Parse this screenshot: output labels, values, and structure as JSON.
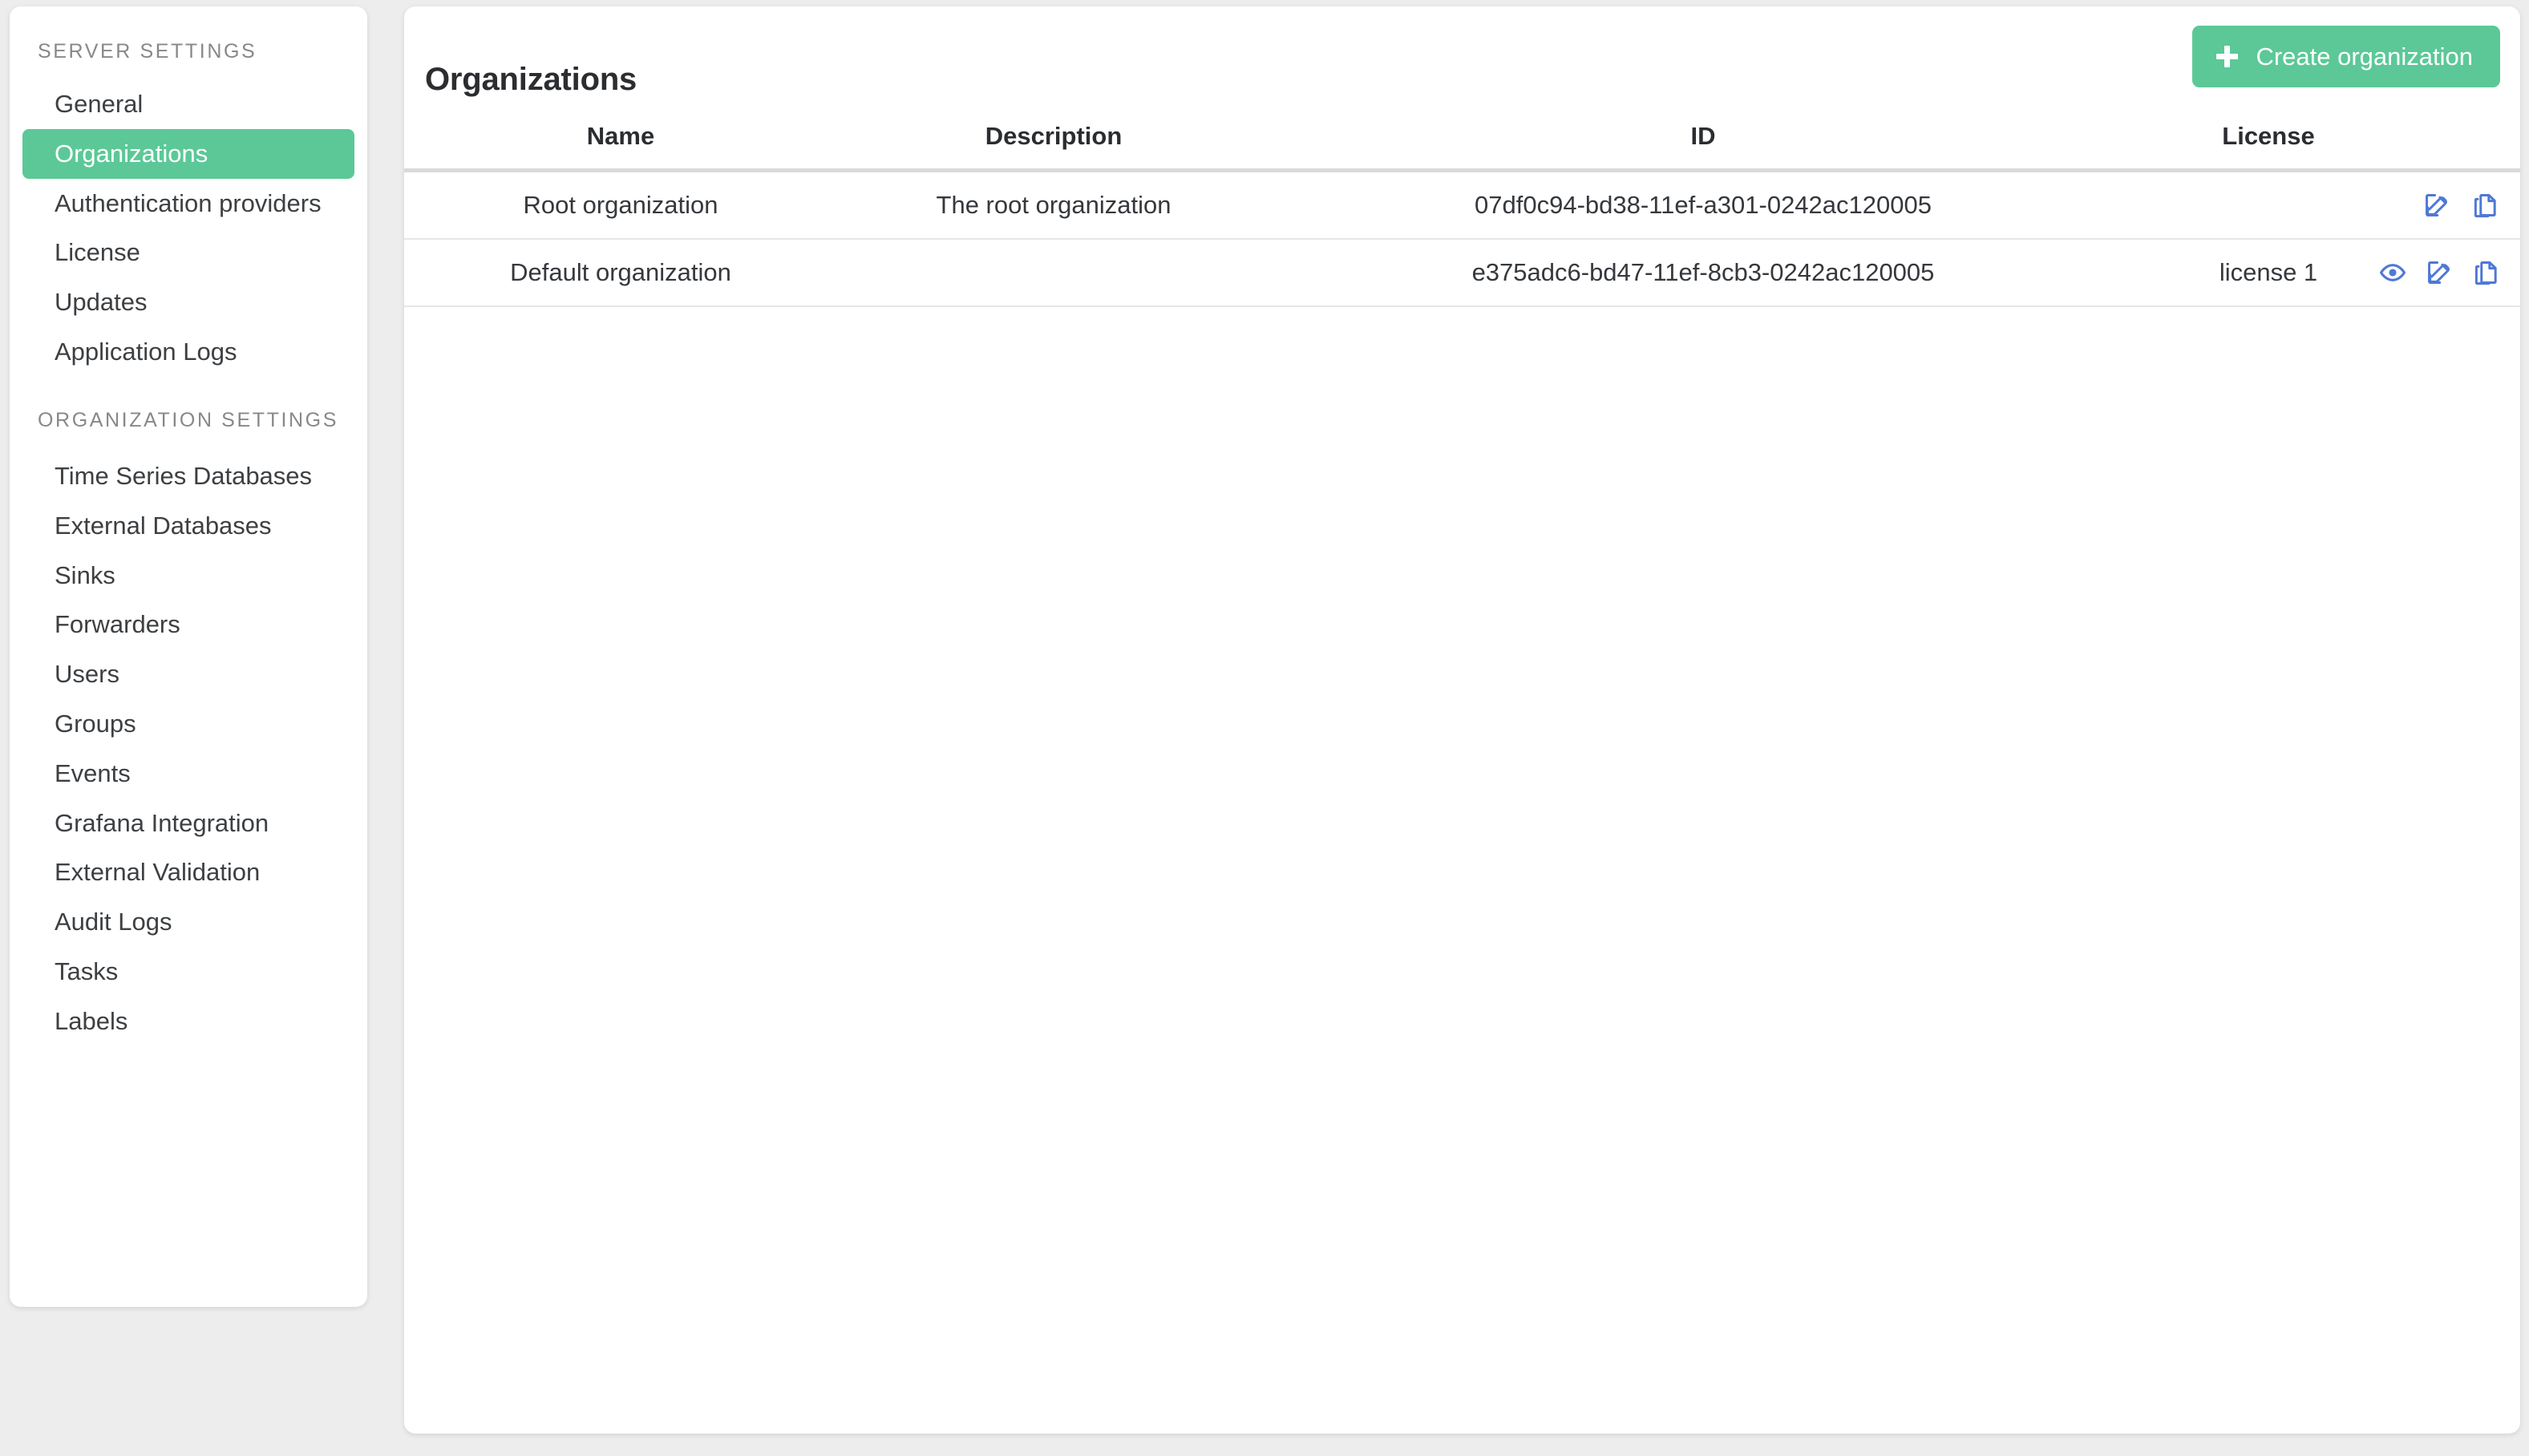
{
  "sidebar": {
    "sections": [
      {
        "title": "SERVER SETTINGS",
        "items": [
          {
            "label": "General",
            "active": false
          },
          {
            "label": "Organizations",
            "active": true
          },
          {
            "label": "Authentication providers",
            "active": false
          },
          {
            "label": "License",
            "active": false
          },
          {
            "label": "Updates",
            "active": false
          },
          {
            "label": "Application Logs",
            "active": false
          }
        ]
      },
      {
        "title": "ORGANIZATION SETTINGS",
        "items": [
          {
            "label": "Time Series Databases",
            "active": false
          },
          {
            "label": "External Databases",
            "active": false
          },
          {
            "label": "Sinks",
            "active": false
          },
          {
            "label": "Forwarders",
            "active": false
          },
          {
            "label": "Users",
            "active": false
          },
          {
            "label": "Groups",
            "active": false
          },
          {
            "label": "Events",
            "active": false
          },
          {
            "label": "Grafana Integration",
            "active": false
          },
          {
            "label": "External Validation",
            "active": false
          },
          {
            "label": "Audit Logs",
            "active": false
          },
          {
            "label": "Tasks",
            "active": false
          },
          {
            "label": "Labels",
            "active": false
          }
        ]
      }
    ]
  },
  "header": {
    "title": "Organizations",
    "create_button_label": "Create organization",
    "create_button_icon": "plus-icon",
    "accent_color": "#5cc897"
  },
  "table": {
    "columns": [
      "Name",
      "Description",
      "ID",
      "License"
    ],
    "rows": [
      {
        "name": "Root organization",
        "description": "The root organization",
        "id": "07df0c94-bd38-11ef-a301-0242ac120005",
        "license": "",
        "actions": [
          "edit-icon",
          "copy-icon"
        ]
      },
      {
        "name": "Default organization",
        "description": "",
        "id": "e375adc6-bd47-11ef-8cb3-0242ac120005",
        "license": "license 1",
        "actions": [
          "eye-icon",
          "edit-icon",
          "copy-icon"
        ]
      }
    ],
    "action_icon_color": "#4f78d6"
  }
}
